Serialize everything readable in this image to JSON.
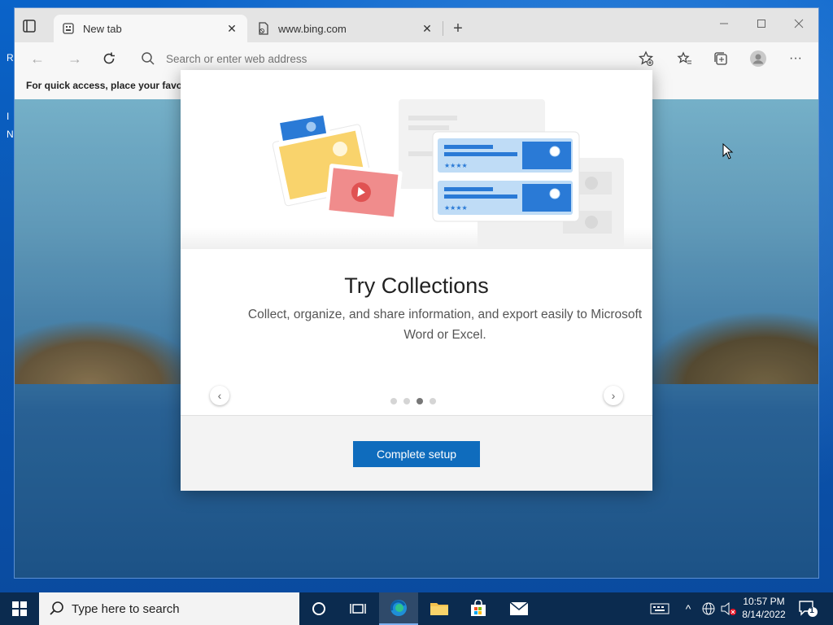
{
  "desktop": {
    "edge_chars": [
      "R",
      "I",
      "N"
    ]
  },
  "browser": {
    "tabs": [
      {
        "title": "New tab",
        "active": true,
        "icon": "new-tab-page-icon"
      },
      {
        "title": "www.bing.com",
        "active": false,
        "icon": "page-document-icon"
      }
    ],
    "address": {
      "placeholder": "Search or enter web address",
      "value": ""
    },
    "favorites_bar_text": "For quick access, place your favorit"
  },
  "modal": {
    "title": "Try Collections",
    "description": "Collect, organize, and share information, and export easily to Microsoft Word or Excel.",
    "pager": {
      "total": 4,
      "active_index": 2
    },
    "primary_button": "Complete setup",
    "accent": "#0f6cbd"
  },
  "taskbar": {
    "search_placeholder": "Type here to search",
    "clock_time": "10:57 PM",
    "clock_date": "8/14/2022",
    "notification_count": "1"
  }
}
